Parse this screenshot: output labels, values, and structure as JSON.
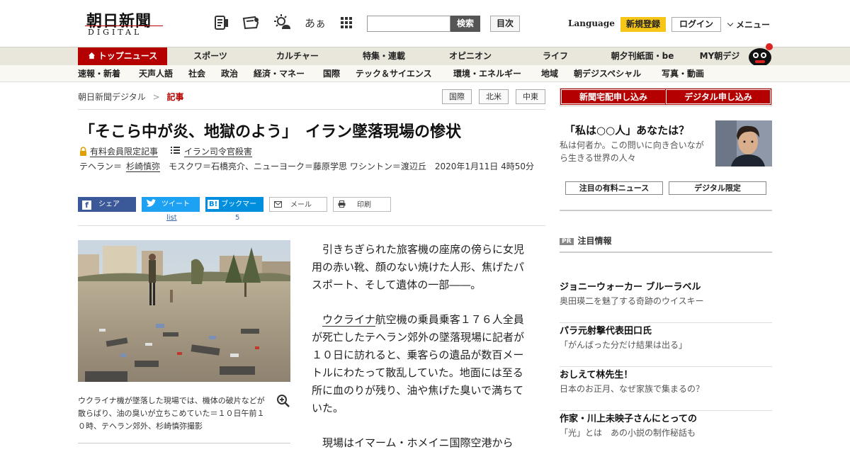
{
  "header": {
    "logo_jp": "朝日新聞",
    "logo_en": "DIGITAL",
    "search_button": "検索",
    "toc_button": "目次",
    "language": "Language",
    "register": "新規登録",
    "login": "ログイン",
    "menu": "メニュー",
    "icons": [
      "news-icon",
      "truck-icon",
      "weather-icon",
      "font-size-icon",
      "grid-icon"
    ],
    "font_size_glyph": "あぁ"
  },
  "nav_primary": [
    "トップニュース",
    "スポーツ",
    "カルチャー",
    "特集・連載",
    "オピニオン",
    "ライフ",
    "朝夕刊紙面・be",
    "MY朝デジ"
  ],
  "nav_secondary": [
    "速報・新着",
    "天声人語",
    "社会",
    "政治",
    "経済・マネー",
    "国際",
    "テック＆サイエンス",
    "環境・エネルギー",
    "地域",
    "朝デジスペシャル",
    "写真・動画"
  ],
  "breadcrumb": {
    "home": "朝日新聞デジタル",
    "separator": ">",
    "current": "記事"
  },
  "tags": [
    "国際",
    "北米",
    "中東"
  ],
  "article": {
    "title": "「そこら中が炎、地獄のよう」　イラン墜落現場の惨状",
    "members_only": "有料会員限定記事",
    "series": "イラン司令官殺害",
    "byline_prefix": "テヘラン＝",
    "byline_link": "杉崎慎弥",
    "byline_rest": "　モスクワ＝石橋亮介、ニューヨーク＝藤原学思 ワシントン＝渡辺丘　2020年1月11日 4時50分",
    "caption": "ウクライナ機が墜落した現場では、機体の破片などが散らばり、油の臭いが立ちこめていた＝１０日午前１０時、テヘラン郊外、杉崎慎弥撮影",
    "para1": "引きちぎられた旅客機の座席の傍らに女児用の赤い靴、顔のない焼けた人形、焦げたパスポート、そして遺体の一部――。",
    "para2_link": "ウクライナ",
    "para2_rest": "航空機の乗員乗客１７６人全員が死亡したテヘラン郊外の墜落現場に記者が１０日に訪れると、乗客らの遺品が数百メートルにわたって散乱していた。地面には至る所に血のりが残り、油や焦げた臭いで満ちていた。",
    "para3": "現場はイマーム・ホメイニ国際空港から"
  },
  "share": {
    "facebook": "シェア",
    "twitter": "ツイート",
    "hatena": "ブックマーク",
    "hatena_badge": "B!",
    "mail": "メール",
    "print": "印刷",
    "twitter_count": "list",
    "hatena_count": "5"
  },
  "sidebar": {
    "btn_paper": "新聞宅配申し込み",
    "btn_digital": "デジタル申し込み",
    "feature_title": "「私は○○人」あなたは？",
    "feature_desc": "私は何者か。この問いに向き合いながら生きる世界の人々",
    "tab_news": "注目の有料ニュース",
    "tab_digital": "デジタル限定",
    "pr_badge": "PR",
    "pr_title": "注目情報",
    "pr_items": [
      {
        "title": "ジョニーウォーカー ブルーラベル",
        "sub": "奥田瑛二を魅了する奇跡のウイスキー"
      },
      {
        "title": "パラ元射撃代表田口氏",
        "sub": "「がんばった分だけ結果は出る」"
      },
      {
        "title": "おしえて林先生！",
        "sub": "日本のお正月、なぜ家族で集まるの？"
      },
      {
        "title": "作家・川上未映子さんにとっての",
        "sub": "「光」とは　あの小説の制作秘話も"
      }
    ]
  },
  "colors": {
    "brand_red": "#b40000",
    "register_yellow": "#f5c518",
    "facebook": "#3b5998",
    "twitter": "#1da1f2",
    "hatena": "#008fde"
  }
}
